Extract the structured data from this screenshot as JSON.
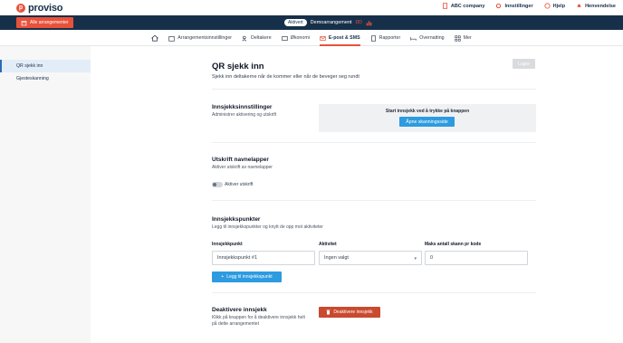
{
  "brand": {
    "logo_text": "proviso",
    "logo_letter": "p"
  },
  "topbar": {
    "company": "ABC company",
    "settings": "Innstillinger",
    "help": "Hjelp",
    "notifications": "Henvendelse"
  },
  "eventbar": {
    "all_events_label": "Alle arrangementer",
    "status_pill": "Aktivert",
    "event_name": "Demoarrangement",
    "event_code": "DD"
  },
  "nav": {
    "items": [
      {
        "label": "",
        "icon": "home-icon"
      },
      {
        "label": "Arrangementsinnstillinger",
        "icon": "calendar-icon"
      },
      {
        "label": "Deltakere",
        "icon": "users-icon"
      },
      {
        "label": "Økonomi",
        "icon": "wallet-icon"
      },
      {
        "label": "E-post & SMS",
        "icon": "mail-icon"
      },
      {
        "label": "Rapporter",
        "icon": "report-icon"
      },
      {
        "label": "Overnatting",
        "icon": "bed-icon"
      },
      {
        "label": "Mer",
        "icon": "grid-icon"
      }
    ]
  },
  "sidebar": {
    "items": [
      {
        "label": "QR sjekk inn"
      },
      {
        "label": "Gjesteskanning"
      }
    ]
  },
  "page": {
    "title": "QR sjekk inn",
    "subtitle": "Sjekk inn deltakerne når de kommer eller når de beveger seg rundt",
    "save_label": "Lagre"
  },
  "checkin_settings": {
    "title": "Innsjekksinnstillinger",
    "desc": "Administrer aktivering og utskrift",
    "scan_text": "Start innsjekk ved å trykke på knappen",
    "scan_button": "Åpne skanningsside"
  },
  "name_tags": {
    "title": "Utskrift navnelapper",
    "desc": "Aktiver utskrift av navnelapper",
    "toggle_label": "Aktiver utskrift"
  },
  "checkpoints": {
    "title": "Innsjekkspunkter",
    "desc": "Legg til innsjekkspunkter og knytt de opp mot aktiviteter",
    "col_point": "Innsjekkpunkt",
    "col_activity": "Aktivitet",
    "col_max": "Maks antall skann pr kode",
    "point_value": "Innsjekkspunkt #1",
    "activity_value": "Ingen valgt",
    "max_value": "0",
    "add_button": "Legg til innsjekkspunkt"
  },
  "deactivate": {
    "title": "Deaktivere innsjekk",
    "desc_line1": "Klikk på knappen for å deaktivere innsjekk helt",
    "desc_line2": "på dette arrangementet",
    "button": "Deaktivere innsjekk"
  },
  "colors": {
    "brand_orange": "#e8523a",
    "navy": "#17304a",
    "blue": "#2d9be0",
    "danger": "#c94a2e"
  }
}
